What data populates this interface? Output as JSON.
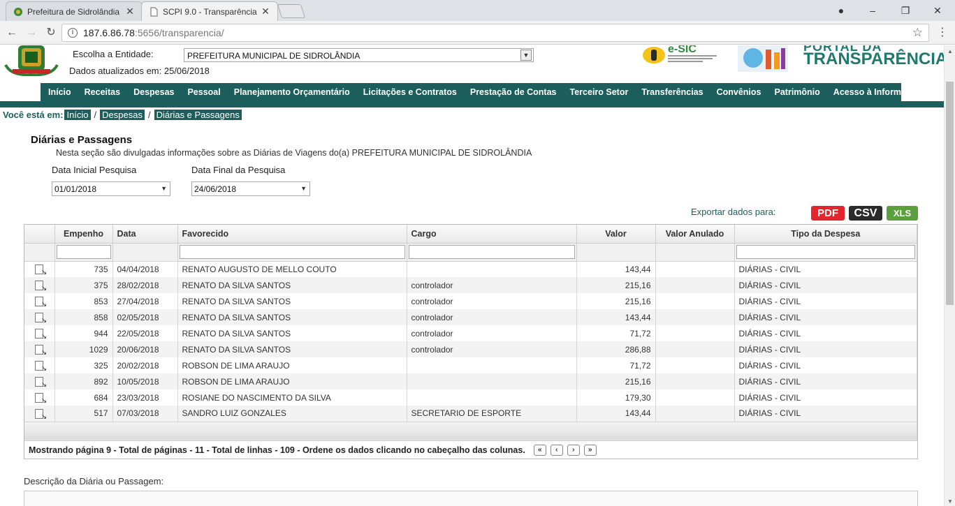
{
  "browser": {
    "tabs": [
      {
        "title": "Prefeitura de Sidrolândia",
        "active": false
      },
      {
        "title": "SCPI 9.0 - Transparência",
        "active": true
      }
    ],
    "url_host": "187.6.86.78",
    "url_rest": ":5656/transparencia/"
  },
  "header": {
    "entidade_label": "Escolha a Entidade:",
    "entidade_value": "PREFEITURA MUNICIPAL DE SIDROLÂNDIA",
    "atualizado": "Dados atualizados em: 25/06/2018",
    "esic": "e-SIC",
    "portal_top": "PORTAL DA",
    "portal": "TRANSPARÊNCIA"
  },
  "menu": [
    "Início",
    "Receitas",
    "Despesas",
    "Pessoal",
    "Planejamento Orçamentário",
    "Licitações e Contratos",
    "Prestação de Contas",
    "Terceiro Setor",
    "Transferências",
    "Convênios",
    "Patrimônio",
    "Acesso à Informação"
  ],
  "breadcrumb": {
    "label": "Você está em:",
    "items": [
      "Início",
      "Despesas",
      "Diárias e Passagens"
    ]
  },
  "section": {
    "title": "Diárias e Passagens",
    "desc": "Nesta seção são divulgadas informações sobre as Diárias de Viagens do(a) PREFEITURA MUNICIPAL DE SIDROLÂNDIA",
    "data_inicial_label": "Data Inicial Pesquisa",
    "data_inicial": "01/01/2018",
    "data_final_label": "Data Final da Pesquisa",
    "data_final": "24/06/2018"
  },
  "export": {
    "label": "Exportar dados para:",
    "pdf": "PDF",
    "csv": "CSV",
    "xls": "XLS"
  },
  "grid": {
    "columns": [
      "",
      "Empenho",
      "Data",
      "Favorecido",
      "Cargo",
      "Valor",
      "Valor Anulado",
      "Tipo da Despesa"
    ],
    "rows": [
      {
        "empenho": "735",
        "data": "04/04/2018",
        "favorecido": "RENATO AUGUSTO DE MELLO COUTO",
        "cargo": "",
        "valor": "143,44",
        "anulado": "",
        "tipo": "DIÁRIAS - CIVIL"
      },
      {
        "empenho": "375",
        "data": "28/02/2018",
        "favorecido": "RENATO DA SILVA SANTOS",
        "cargo": "controlador",
        "valor": "215,16",
        "anulado": "",
        "tipo": "DIÁRIAS - CIVIL"
      },
      {
        "empenho": "853",
        "data": "27/04/2018",
        "favorecido": "RENATO DA SILVA SANTOS",
        "cargo": "controlador",
        "valor": "215,16",
        "anulado": "",
        "tipo": "DIÁRIAS - CIVIL"
      },
      {
        "empenho": "858",
        "data": "02/05/2018",
        "favorecido": "RENATO DA SILVA SANTOS",
        "cargo": "controlador",
        "valor": "143,44",
        "anulado": "",
        "tipo": "DIÁRIAS - CIVIL"
      },
      {
        "empenho": "944",
        "data": "22/05/2018",
        "favorecido": "RENATO DA SILVA SANTOS",
        "cargo": "controlador",
        "valor": "71,72",
        "anulado": "",
        "tipo": "DIÁRIAS - CIVIL"
      },
      {
        "empenho": "1029",
        "data": "20/06/2018",
        "favorecido": "RENATO DA SILVA SANTOS",
        "cargo": "controlador",
        "valor": "286,88",
        "anulado": "",
        "tipo": "DIÁRIAS - CIVIL"
      },
      {
        "empenho": "325",
        "data": "20/02/2018",
        "favorecido": "ROBSON DE LIMA ARAUJO",
        "cargo": "",
        "valor": "71,72",
        "anulado": "",
        "tipo": "DIÁRIAS - CIVIL"
      },
      {
        "empenho": "892",
        "data": "10/05/2018",
        "favorecido": "ROBSON DE LIMA ARAUJO",
        "cargo": "",
        "valor": "215,16",
        "anulado": "",
        "tipo": "DIÁRIAS - CIVIL"
      },
      {
        "empenho": "684",
        "data": "23/03/2018",
        "favorecido": "ROSIANE DO NASCIMENTO DA SILVA",
        "cargo": "",
        "valor": "179,30",
        "anulado": "",
        "tipo": "DIÁRIAS - CIVIL"
      },
      {
        "empenho": "517",
        "data": "07/03/2018",
        "favorecido": "SANDRO LUIZ GONZALES",
        "cargo": "SECRETARIO DE ESPORTE",
        "valor": "143,44",
        "anulado": "",
        "tipo": "DIÁRIAS - CIVIL"
      }
    ],
    "pager_text": "Mostrando página 9 - Total de páginas - 11 - Total de linhas - 109 - Ordene os dados clicando no cabeçalho das colunas."
  },
  "descricao_label": "Descrição da Diária ou Passagem:",
  "colors": {
    "accent": "#1c5e5b",
    "pdf": "#e3262e",
    "csv": "#2b2b2b",
    "xls": "#5aa03c"
  }
}
